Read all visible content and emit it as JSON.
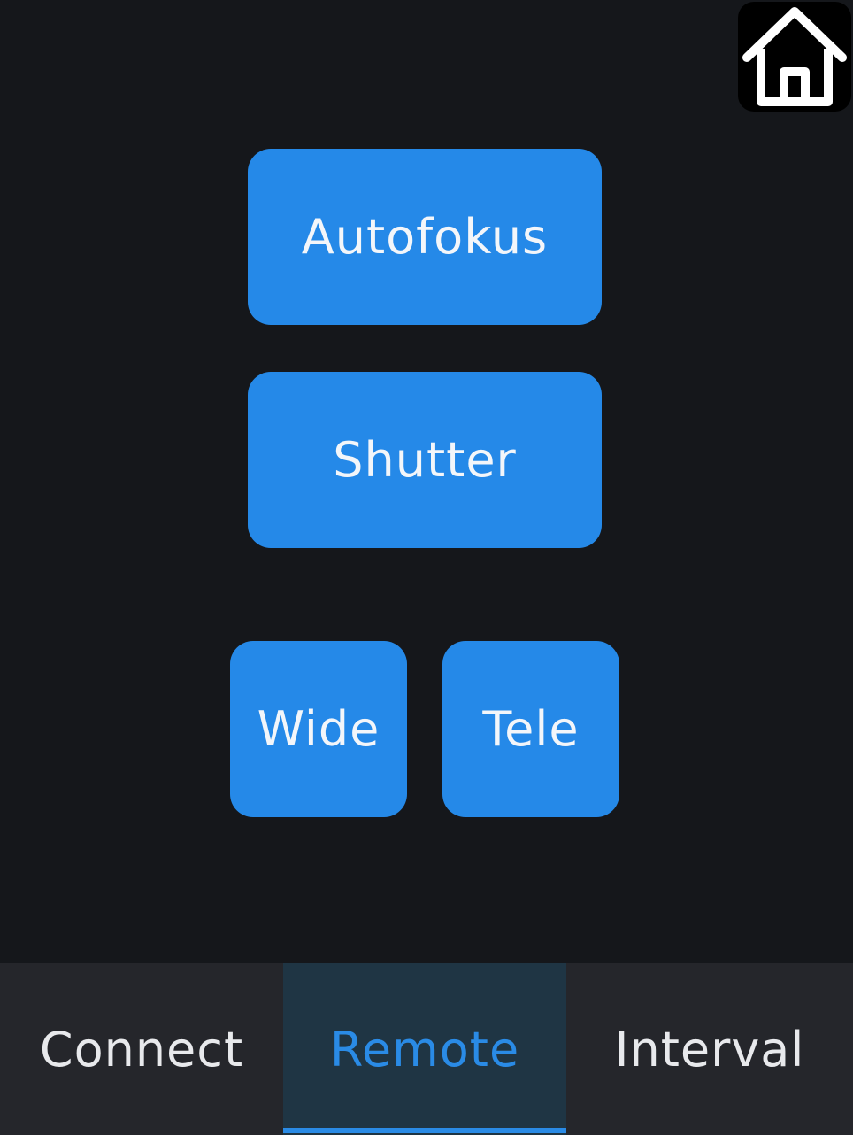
{
  "header": {
    "home_icon": "home-icon"
  },
  "remote": {
    "autofocus_label": "Autofokus",
    "shutter_label": "Shutter",
    "wide_label": "Wide",
    "tele_label": "Tele"
  },
  "tabs": [
    {
      "label": "Connect",
      "active": false
    },
    {
      "label": "Remote",
      "active": true
    },
    {
      "label": "Interval",
      "active": false
    }
  ],
  "colors": {
    "background": "#15171b",
    "button": "#2589e8",
    "tab_bar": "#25262b",
    "tab_active_bg": "#1f3544",
    "accent": "#2a8be6"
  }
}
